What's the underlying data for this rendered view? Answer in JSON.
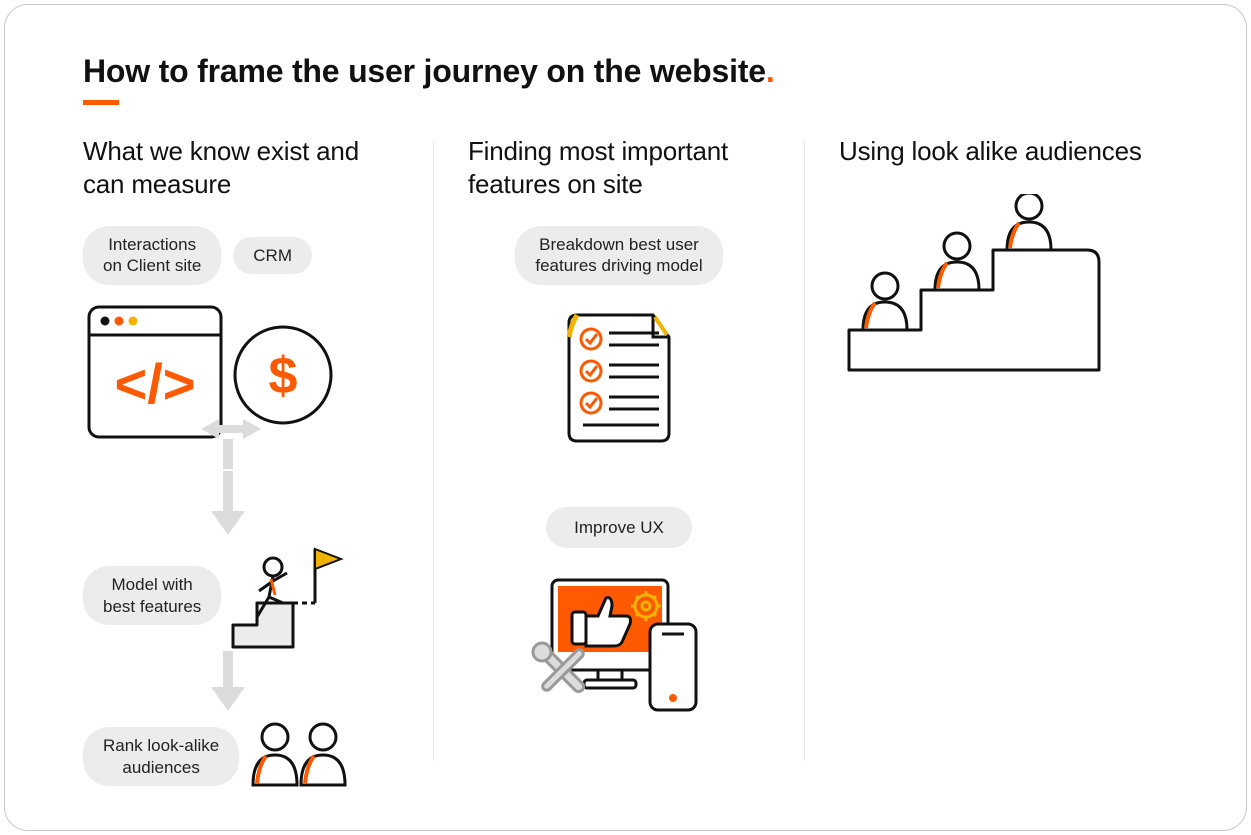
{
  "title": "How to frame the user journey on the website",
  "title_period": ".",
  "columns": {
    "col1": {
      "heading": "What we know exist and can measure",
      "pill_interactions_l1": "Interactions",
      "pill_interactions_l2": "on Client site",
      "pill_crm": "CRM",
      "pill_model_l1": "Model with",
      "pill_model_l2": "best features",
      "pill_rank_l1": "Rank look-alike",
      "pill_rank_l2": "audiences"
    },
    "col2": {
      "heading": "Finding most important features on site",
      "pill_breakdown_l1": "Breakdown best user",
      "pill_breakdown_l2": "features driving model",
      "pill_improve": "Improve UX"
    },
    "col3": {
      "heading": "Using look alike audiences"
    }
  }
}
